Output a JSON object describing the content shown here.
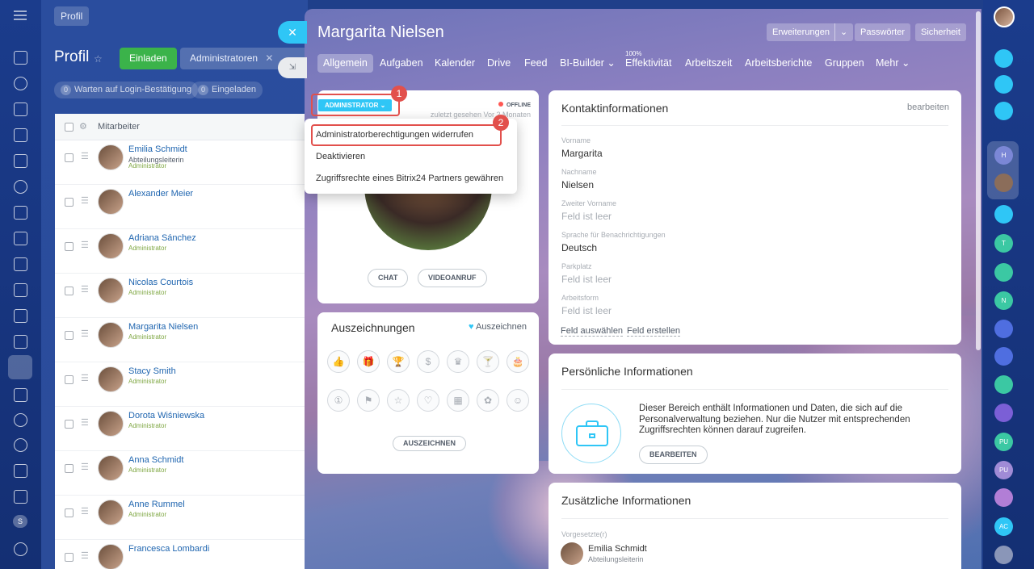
{
  "left_rail": {
    "badge_label": "S"
  },
  "background_page": {
    "breadcrumb": "Profil",
    "title": "Profil",
    "invite_button": "Einladen",
    "filter_chip": "Administratoren",
    "counters": [
      {
        "count": "0",
        "label": "Warten auf Login-Bestätigung"
      },
      {
        "count": "0",
        "label": "Eingeladen"
      }
    ],
    "list_header": "Mitarbeiter",
    "employees": [
      {
        "name": "Emilia Schmidt",
        "position": "Abteilungsleiterin",
        "role": "Administrator"
      },
      {
        "name": "Alexander Meier",
        "position": "",
        "role": ""
      },
      {
        "name": "Adriana Sánchez",
        "position": "",
        "role": "Administrator"
      },
      {
        "name": "Nicolas Courtois",
        "position": "",
        "role": "Administrator"
      },
      {
        "name": "Margarita Nielsen",
        "position": "",
        "role": "Administrator"
      },
      {
        "name": "Stacy Smith",
        "position": "",
        "role": "Administrator"
      },
      {
        "name": "Dorota Wiśniewska",
        "position": "",
        "role": "Administrator"
      },
      {
        "name": "Anna Schmidt",
        "position": "",
        "role": "Administrator"
      },
      {
        "name": "Anne Rummel",
        "position": "",
        "role": "Administrator"
      },
      {
        "name": "Francesca Lombardi",
        "position": "",
        "role": ""
      }
    ]
  },
  "slider": {
    "title": "Margarita Nielsen",
    "header_buttons": {
      "extensions": "Erweiterungen",
      "extensions_caret": "⌄",
      "passwords": "Passwörter",
      "security": "Sicherheit"
    },
    "tabs": [
      {
        "label": "Allgemein"
      },
      {
        "label": "Aufgaben"
      },
      {
        "label": "Kalender"
      },
      {
        "label": "Drive"
      },
      {
        "label": "Feed"
      },
      {
        "label": "BI-Builder ⌄"
      },
      {
        "label": "Effektivität",
        "sup": "100%"
      },
      {
        "label": "Arbeitszeit"
      },
      {
        "label": "Arbeitsberichte"
      },
      {
        "label": "Gruppen"
      },
      {
        "label": "Mehr ⌄"
      }
    ],
    "close_glyph": "✕",
    "minimize_glyph": "⇲",
    "profile": {
      "role_badge": "ADMINISTRATOR ⌄",
      "status": "OFFLINE",
      "last_seen": "zuletzt gesehen Vor 2 Monaten",
      "chat_button": "CHAT",
      "video_button": "VIDEOANRUF"
    },
    "annotations": {
      "step1": "1",
      "step2": "2"
    },
    "role_menu": [
      {
        "label": "Administratorberechtigungen widerrufen"
      },
      {
        "label": "Deaktivieren"
      },
      {
        "label": "Zugriffsrechte eines Bitrix24 Partners gewähren"
      }
    ],
    "awards": {
      "title": "Auszeichnungen",
      "link": "Auszeichnen",
      "button": "AUSZEICHNEN",
      "icons": [
        "like-icon",
        "gift-icon",
        "trophy-icon",
        "money-bag-icon",
        "crown-icon",
        "cocktail-icon",
        "cake-icon",
        "number-one-icon",
        "flag-icon",
        "star-icon",
        "heart-icon",
        "calendar-icon",
        "flower-icon",
        "smile-icon"
      ]
    },
    "contact": {
      "title": "Kontaktinformationen",
      "edit": "bearbeiten",
      "fields": [
        {
          "label": "Vorname",
          "value": "Margarita",
          "empty": false
        },
        {
          "label": "Nachname",
          "value": "Nielsen",
          "empty": false
        },
        {
          "label": "Zweiter Vorname",
          "value": "Feld ist leer",
          "empty": true
        },
        {
          "label": "Sprache für Benachrichtigungen",
          "value": "Deutsch",
          "empty": false
        },
        {
          "label": "Parkplatz",
          "value": "Feld ist leer",
          "empty": true
        },
        {
          "label": "Arbeitsform",
          "value": "Feld ist leer",
          "empty": true
        }
      ],
      "select_field": "Feld auswählen",
      "create_field": "Feld erstellen"
    },
    "personal": {
      "title": "Persönliche Informationen",
      "text": "Dieser Bereich enthält Informationen und Daten, die sich auf die Personalverwaltung beziehen. Nur die Nutzer mit entsprechenden Zugriffsrechten können darauf zugreifen.",
      "button": "BEARBEITEN"
    },
    "additional": {
      "title": "Zusätzliche Informationen",
      "supervisor_label": "Vorgesetzte(r)",
      "supervisor_name": "Emilia Schmidt",
      "supervisor_position": "Abteilungsleiterin"
    }
  },
  "right_rail": {
    "items": [
      {
        "label": "",
        "color": "#2fc6f6",
        "icon": "bell-icon"
      },
      {
        "label": "",
        "color": "#2fc6f6",
        "icon": "target-icon"
      },
      {
        "label": "",
        "color": "#2fc6f6",
        "icon": "search-chat-icon"
      },
      {
        "label": "H",
        "color": "#7b87d6",
        "icon": ""
      },
      {
        "label": "",
        "color": "#8b6d5a",
        "icon": "avatar-icon"
      },
      {
        "label": "",
        "color": "#2fc6f6",
        "icon": "chat-icon"
      },
      {
        "label": "T",
        "color": "#3bc8a3",
        "icon": ""
      },
      {
        "label": "",
        "color": "#3bc8a3",
        "icon": "task-icon"
      },
      {
        "label": "N",
        "color": "#3bc8a3",
        "icon": ""
      },
      {
        "label": "",
        "color": "#4f6ee0",
        "icon": "group-icon"
      },
      {
        "label": "",
        "color": "#4f6ee0",
        "icon": "lock-icon"
      },
      {
        "label": "",
        "color": "#3bc8a3",
        "icon": "task-icon"
      },
      {
        "label": "",
        "color": "#7b5fd6",
        "icon": "target-icon"
      },
      {
        "label": "PU",
        "color": "#3bc8a3",
        "icon": ""
      },
      {
        "label": "PU",
        "color": "#a08bd6",
        "icon": ""
      },
      {
        "label": "",
        "color": "#b27ed6",
        "icon": "lock-icon"
      },
      {
        "label": "AC",
        "color": "#2fc6f6",
        "icon": ""
      },
      {
        "label": "",
        "color": "#8a96b8",
        "icon": "user-icon"
      }
    ]
  }
}
